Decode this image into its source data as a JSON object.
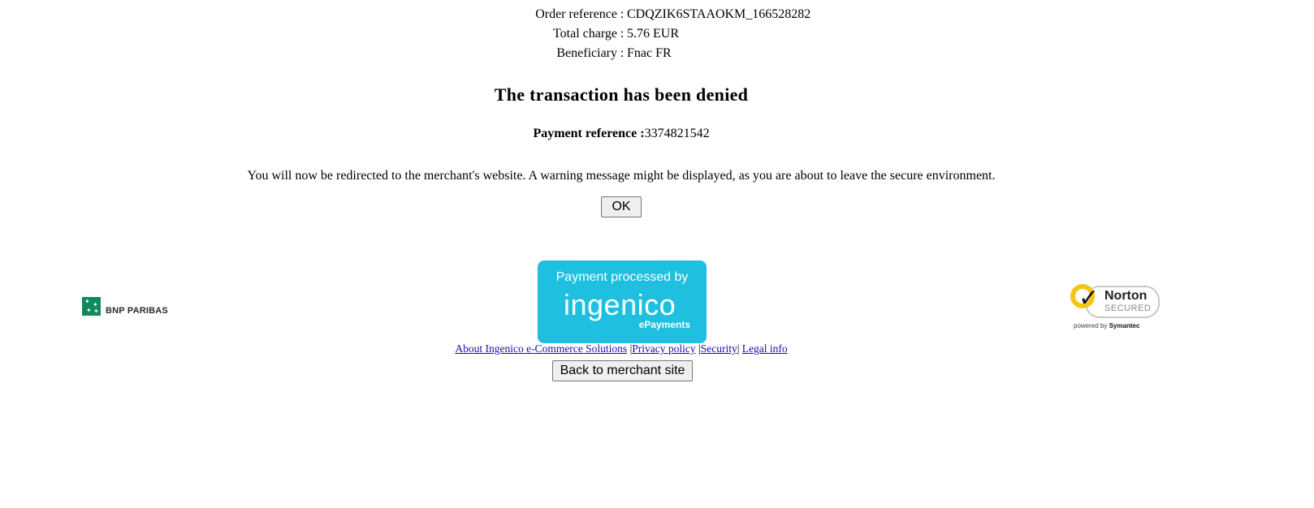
{
  "order": {
    "reference_label": "Order reference",
    "reference_value": "CDQZIK6STAAOKM_166528282",
    "charge_label": "Total charge",
    "charge_value": "5.76 EUR",
    "beneficiary_label": "Beneficiary",
    "beneficiary_value": "Fnac FR",
    "separator": ":"
  },
  "status": {
    "title": "The transaction has been denied",
    "payment_reference_label": "Payment reference :",
    "payment_reference_value": "3374821542",
    "redirect_message": "You will now be redirected to the merchant's website. A warning message might be displayed, as you are about to leave the secure environment.",
    "ok_button": "OK"
  },
  "logos": {
    "bank_name": "BNP PARIBAS",
    "processor_caption": "Payment processed by",
    "processor_name": "ingenico",
    "processor_sub": "ePayments",
    "norton_name": "Norton",
    "norton_secured": "SECURED",
    "norton_powered_by": "powered by",
    "norton_symantec": "Symantec"
  },
  "footer": {
    "links": [
      "About Ingenico e-Commerce Solutions",
      "Privacy policy",
      "Security",
      "Legal info"
    ],
    "separator": "|",
    "back_button": "Back to merchant site"
  },
  "colors": {
    "ingenico_bg": "#1ebfdf",
    "bnp_green": "#0f8a5c",
    "norton_yellow": "#f5c518",
    "link": "#1a0dab"
  },
  "icons": [
    "bnp-paribas-logo-icon",
    "ingenico-logo-icon",
    "norton-checkmark-icon"
  ]
}
